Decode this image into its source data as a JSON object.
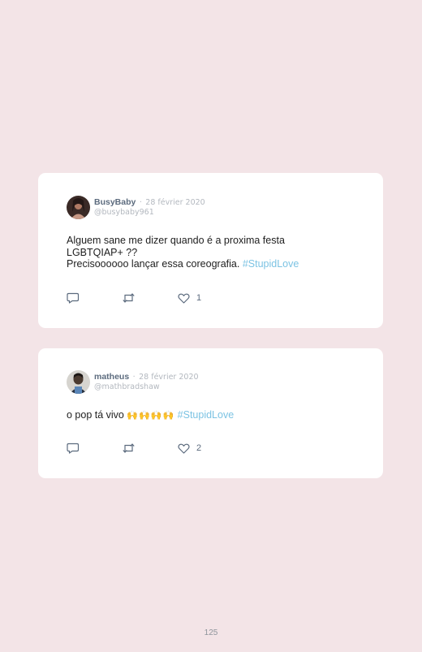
{
  "tweets": [
    {
      "name": "BusyBaby",
      "separator": "·",
      "date": "28 février 2020",
      "handle": "@busybaby961",
      "text_line1": "Alguem sane me dizer quando é a proxima festa LGBTQIAP+ ??",
      "text_line2": "Precisoooooo lançar essa coreografia.",
      "hashtag": "#StupidLove",
      "likes": "1"
    },
    {
      "name": "matheus",
      "separator": "·",
      "date": "28 février 2020",
      "handle": "@mathbradshaw",
      "text_line1": "o pop tá vivo",
      "emoji": "🙌🙌🙌🙌",
      "hashtag": "#StupidLove",
      "likes": "2"
    }
  ],
  "icons": {
    "reply": "reply-icon",
    "retweet": "retweet-icon",
    "like": "heart-icon"
  },
  "colors": {
    "background": "#f3e4e7",
    "card": "#ffffff",
    "name": "#5c6b7e",
    "muted": "#b3b8bf",
    "hashtag": "#7cc3e3"
  },
  "page_number": "125"
}
